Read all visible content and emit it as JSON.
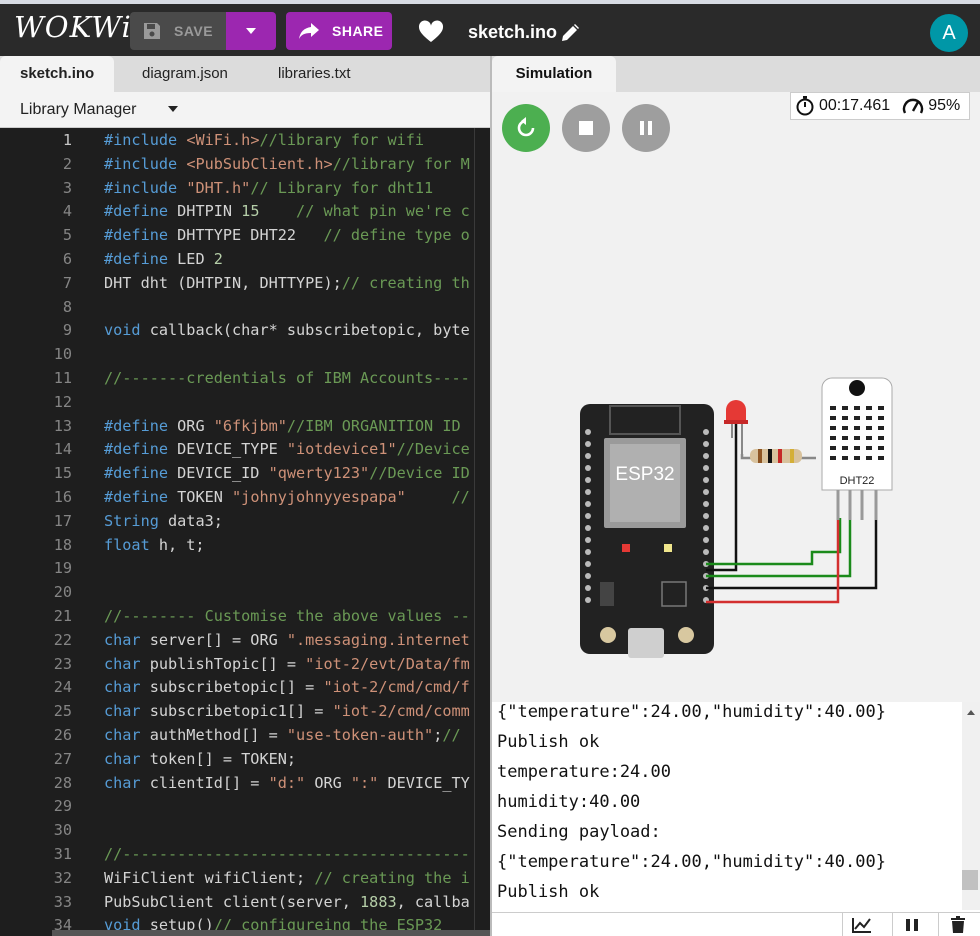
{
  "header": {
    "logo": "WOKWi",
    "save_label": "SAVE",
    "share_label": "SHARE",
    "project_name": "sketch.ino",
    "avatar_letter": "A"
  },
  "editor": {
    "tabs": [
      {
        "label": "sketch.ino",
        "active": true
      },
      {
        "label": "diagram.json",
        "active": false
      },
      {
        "label": "libraries.txt",
        "active": false
      }
    ],
    "library_manager_label": "Library Manager",
    "lines": [
      {
        "no": "1",
        "code": "#include <WiFi.h>//library for wifi"
      },
      {
        "no": "2",
        "code": "#include <PubSubClient.h>//library for M"
      },
      {
        "no": "3",
        "code": "#include \"DHT.h\"// Library for dht11"
      },
      {
        "no": "4",
        "code": "#define DHTPIN 15    // what pin we're c"
      },
      {
        "no": "5",
        "code": "#define DHTTYPE DHT22   // define type o"
      },
      {
        "no": "6",
        "code": "#define LED 2"
      },
      {
        "no": "7",
        "code": "DHT dht (DHTPIN, DHTTYPE);// creating th"
      },
      {
        "no": "8",
        "code": ""
      },
      {
        "no": "9",
        "code": "void callback(char* subscribetopic, byte"
      },
      {
        "no": "10",
        "code": ""
      },
      {
        "no": "11",
        "code": "//-------credentials of IBM Accounts----"
      },
      {
        "no": "12",
        "code": ""
      },
      {
        "no": "13",
        "code": "#define ORG \"6fkjbm\"//IBM ORGANITION ID"
      },
      {
        "no": "14",
        "code": "#define DEVICE_TYPE \"iotdevice1\"//Device"
      },
      {
        "no": "15",
        "code": "#define DEVICE_ID \"qwerty123\"//Device ID"
      },
      {
        "no": "16",
        "code": "#define TOKEN \"johnyjohnyyespapa\"     //"
      },
      {
        "no": "17",
        "code": "String data3;"
      },
      {
        "no": "18",
        "code": "float h, t;"
      },
      {
        "no": "19",
        "code": ""
      },
      {
        "no": "20",
        "code": ""
      },
      {
        "no": "21",
        "code": "//-------- Customise the above values --"
      },
      {
        "no": "22",
        "code": "char server[] = ORG \".messaging.internet"
      },
      {
        "no": "23",
        "code": "char publishTopic[] = \"iot-2/evt/Data/fm"
      },
      {
        "no": "24",
        "code": "char subscribetopic[] = \"iot-2/cmd/cmd/f"
      },
      {
        "no": "25",
        "code": "char subscribetopic1[] = \"iot-2/cmd/comm"
      },
      {
        "no": "26",
        "code": "char authMethod[] = \"use-token-auth\";//"
      },
      {
        "no": "27",
        "code": "char token[] = TOKEN;"
      },
      {
        "no": "28",
        "code": "char clientId[] = \"d:\" ORG \":\" DEVICE_TY"
      },
      {
        "no": "29",
        "code": ""
      },
      {
        "no": "30",
        "code": ""
      },
      {
        "no": "31",
        "code": "//--------------------------------------"
      },
      {
        "no": "32",
        "code": "WiFiClient wifiClient; // creating the i"
      },
      {
        "no": "33",
        "code": "PubSubClient client(server, 1883, callba"
      },
      {
        "no": "34",
        "code": "void setup()// configureing the ESP32"
      }
    ]
  },
  "simulation": {
    "tab_label": "Simulation",
    "timer": "00:17.461",
    "speed": "95%",
    "board_label": "ESP32",
    "sensor_label": "DHT22"
  },
  "serial": {
    "lines": [
      "{\"temperature\":24.00,\"humidity\":40.00}",
      "Publish ok",
      "temperature:24.00",
      "humidity:40.00",
      "Sending payload:",
      "{\"temperature\":24.00,\"humidity\":40.00}",
      "Publish ok"
    ]
  },
  "colors": {
    "accent": "#9c27b0",
    "avatar": "#0097a7",
    "restart": "#4caf50",
    "control_grey": "#9e9e9e"
  }
}
